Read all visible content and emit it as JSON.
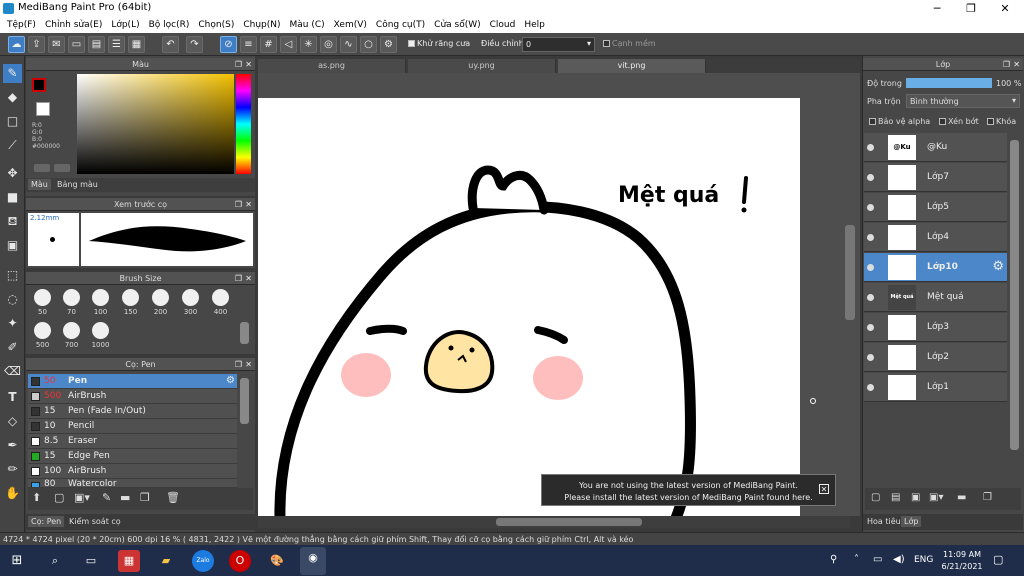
{
  "window": {
    "title": "MediBang Paint Pro (64bit)",
    "minimize": "─",
    "maximize": "❐",
    "close": "✕"
  },
  "menu": [
    "Tệp(F)",
    "Chỉnh sửa(E)",
    "Lớp(L)",
    "Bộ lọc(R)",
    "Chọn(S)",
    "Chụp(N)",
    "Màu (C)",
    "Xem(V)",
    "Công cụ(T)",
    "Cửa sổ(W)",
    "Cloud",
    "Help"
  ],
  "toolbar": {
    "antialias_label": "Khử răng cưa",
    "adjust_label": "Điều chỉnh",
    "adjust_value": "0",
    "margin_label": "Cạnh mềm"
  },
  "color_panel": {
    "title": "Màu",
    "r": "R:0",
    "g": "G:0",
    "b": "B:0",
    "hex": "#000000",
    "tab_color": "Màu",
    "tab_palette": "Bảng màu"
  },
  "brush_preview": {
    "title": "Xem trước cọ",
    "size": "2.12mm"
  },
  "brush_size": {
    "title": "Brush Size",
    "sizes": [
      "50",
      "70",
      "100",
      "150",
      "200",
      "300",
      "400",
      "500",
      "700",
      "1000"
    ]
  },
  "brush_list": {
    "title": "Cọ: Pen",
    "items": [
      {
        "size": "50",
        "name": "Pen",
        "color": "#333333"
      },
      {
        "size": "500",
        "name": "AirBrush",
        "color": "#cccccc"
      },
      {
        "size": "15",
        "name": "Pen (Fade In/Out)",
        "color": "#333333"
      },
      {
        "size": "10",
        "name": "Pencil",
        "color": "#333333"
      },
      {
        "size": "8.5",
        "name": "Eraser",
        "color": "#ffffff"
      },
      {
        "size": "15",
        "name": "Edge Pen",
        "color": "#22aa22"
      },
      {
        "size": "100",
        "name": "AirBrush",
        "color": "#ffffff"
      },
      {
        "size": "80",
        "name": "Watercolor",
        "color": "#3aa0e8"
      }
    ],
    "tab_pen": "Cọ: Pen",
    "tab_control": "Kiểm soát cọ"
  },
  "tabs": [
    "as.png",
    "uy.png",
    "vit.png"
  ],
  "canvas_text": "Mệt quá",
  "notification": {
    "line1": "You are not using the latest version of MediBang Paint.",
    "line2": "Please install the latest version of MediBang Paint found here."
  },
  "layer_panel": {
    "title": "Lớp",
    "opacity_label": "Độ trong",
    "opacity_value": "100 %",
    "opacity": 1.0,
    "blend_label": "Pha trộn",
    "blend_value": "Bình thường",
    "protect_alpha": "Bảo vệ alpha",
    "clipping": "Xén bớt",
    "lock": "Khóa",
    "layers": [
      {
        "name": "@Ku",
        "thumb": "@Ku"
      },
      {
        "name": "Lớp7",
        "thumb": ""
      },
      {
        "name": "Lớp5",
        "thumb": ""
      },
      {
        "name": "Lớp4",
        "thumb": ""
      },
      {
        "name": "Lớp10",
        "thumb": ""
      },
      {
        "name": "Mệt quá",
        "thumb": "Mệt quá"
      },
      {
        "name": "Lớp3",
        "thumb": ""
      },
      {
        "name": "Lớp2",
        "thumb": ""
      },
      {
        "name": "Lớp1",
        "thumb": ""
      }
    ],
    "tab_nav": "Hoa tiêu",
    "tab_layer": "Lớp"
  },
  "status": "4724 * 4724 pixel  (20 * 20cm)  600 dpi  16 %  ( 4831, 2422 )  Vẽ một đường thẳng bằng cách giữ phím Shift, Thay đổi cỡ cọ bằng cách giữ phím Ctrl, Alt và kéo",
  "taskbar": {
    "time": "11:09 AM",
    "date": "6/21/2021",
    "lang": "ENG",
    "zalo": "Zalo"
  }
}
